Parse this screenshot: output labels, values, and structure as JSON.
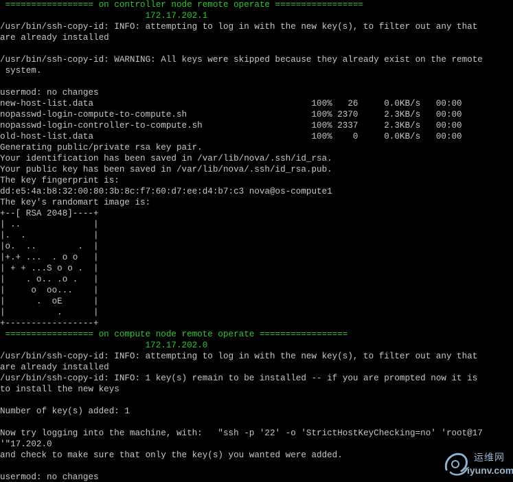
{
  "terminal": {
    "text_color": "#c8c8c8",
    "highlight_color": "#32c832",
    "background": "#000000",
    "lines": [
      {
        "text": " ================= on controller node remote operate =================",
        "color": "green"
      },
      {
        "text": "                            172.17.202.1",
        "color": "green"
      },
      {
        "text": "/usr/bin/ssh-copy-id: INFO: attempting to log in with the new key(s), to filter out any that",
        "color": "normal"
      },
      {
        "text": "are already installed",
        "color": "normal"
      },
      {
        "text": "",
        "color": "normal"
      },
      {
        "text": "/usr/bin/ssh-copy-id: WARNING: All keys were skipped because they already exist on the remote",
        "color": "normal"
      },
      {
        "text": " system.",
        "color": "normal"
      },
      {
        "text": "",
        "color": "normal"
      },
      {
        "text": "usermod: no changes",
        "color": "normal"
      },
      {
        "text": "new-host-list.data                                          100%   26     0.0KB/s   00:00",
        "color": "normal"
      },
      {
        "text": "nopasswd-login-compute-to-compute.sh                        100% 2370     2.3KB/s   00:00",
        "color": "normal"
      },
      {
        "text": "nopasswd-login-controller-to-compute.sh                     100% 2337     2.3KB/s   00:00",
        "color": "normal"
      },
      {
        "text": "old-host-list.data                                          100%    0     0.0KB/s   00:00",
        "color": "normal"
      },
      {
        "text": "Generating public/private rsa key pair.",
        "color": "normal"
      },
      {
        "text": "Your identification has been saved in /var/lib/nova/.ssh/id_rsa.",
        "color": "normal"
      },
      {
        "text": "Your public key has been saved in /var/lib/nova/.ssh/id_rsa.pub.",
        "color": "normal"
      },
      {
        "text": "The key fingerprint is:",
        "color": "normal"
      },
      {
        "text": "dd:e5:4a:b8:32:00:80:3b:8c:f7:60:d7:ee:d4:b7:c3 nova@os-compute1",
        "color": "normal"
      },
      {
        "text": "The key's randomart image is:",
        "color": "normal"
      },
      {
        "text": "+--[ RSA 2048]----+",
        "color": "normal"
      },
      {
        "text": "| ..              |",
        "color": "normal"
      },
      {
        "text": "|.  .             |",
        "color": "normal"
      },
      {
        "text": "|o.  ..        .  |",
        "color": "normal"
      },
      {
        "text": "|+.+ ...  . o o   |",
        "color": "normal"
      },
      {
        "text": "| + + ...S o o .  |",
        "color": "normal"
      },
      {
        "text": "|    . o.. .o .   |",
        "color": "normal"
      },
      {
        "text": "|     o  oo...    |",
        "color": "normal"
      },
      {
        "text": "|      .  oE      |",
        "color": "normal"
      },
      {
        "text": "|          .      |",
        "color": "normal"
      },
      {
        "text": "+-----------------+",
        "color": "normal"
      },
      {
        "text": " ================= on compute node remote operate =================",
        "color": "green"
      },
      {
        "text": "                            172.17.202.0",
        "color": "green"
      },
      {
        "text": "/usr/bin/ssh-copy-id: INFO: attempting to log in with the new key(s), to filter out any that",
        "color": "normal"
      },
      {
        "text": "are already installed",
        "color": "normal"
      },
      {
        "text": "/usr/bin/ssh-copy-id: INFO: 1 key(s) remain to be installed -- if you are prompted now it is",
        "color": "normal"
      },
      {
        "text": "to install the new keys",
        "color": "normal"
      },
      {
        "text": "",
        "color": "normal"
      },
      {
        "text": "Number of key(s) added: 1",
        "color": "normal"
      },
      {
        "text": "",
        "color": "normal"
      },
      {
        "text": "Now try logging into the machine, with:   \"ssh -p '22' -o 'StrictHostKeyChecking=no' 'root@17",
        "color": "normal"
      },
      {
        "text": "'\"17.202.0",
        "color": "normal"
      },
      {
        "text": "and check to make sure that only the key(s) you wanted were added.",
        "color": "normal"
      },
      {
        "text": "",
        "color": "normal"
      },
      {
        "text": "usermod: no changes",
        "color": "normal"
      }
    ]
  },
  "watermark": {
    "name_cn": "运维网",
    "url": "iyunv.com",
    "icon": "swirl-logo-icon"
  }
}
